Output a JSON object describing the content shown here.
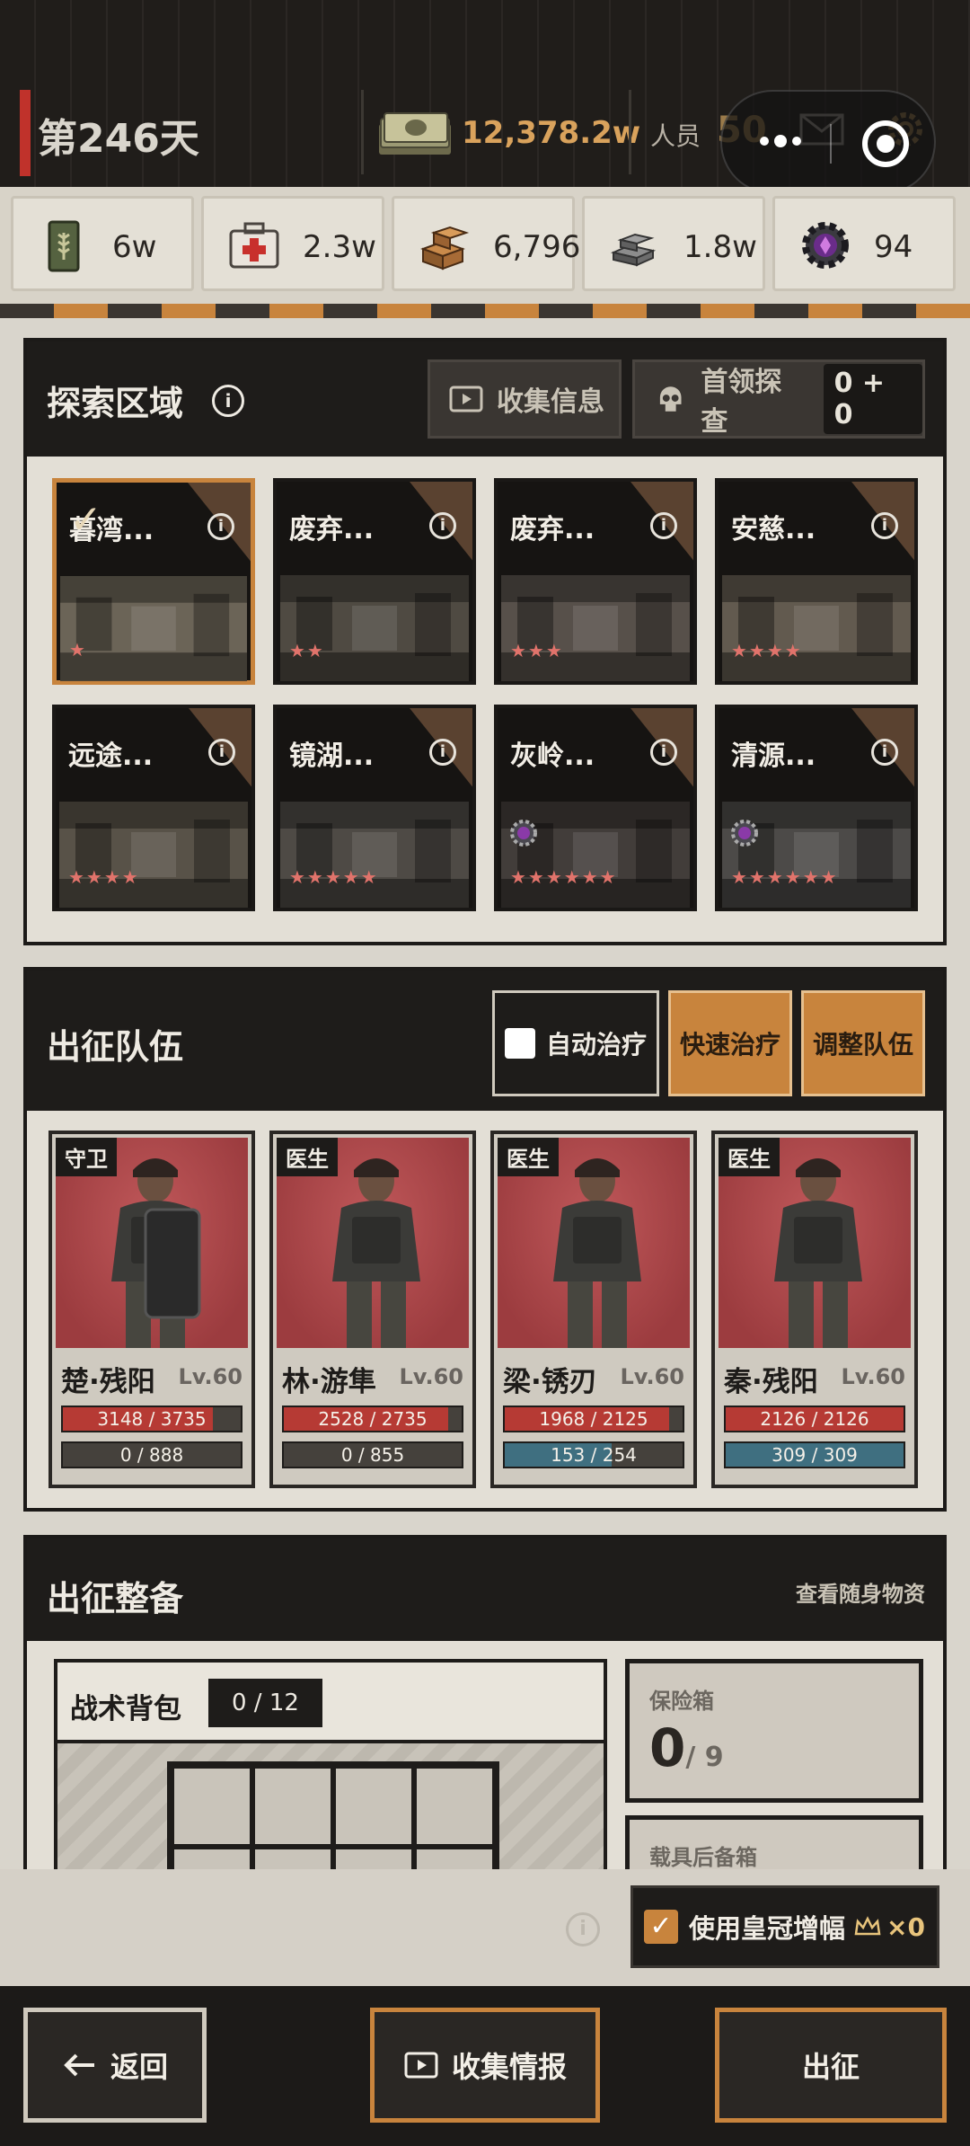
{
  "header": {
    "day": "第246天",
    "money": "12,378.2w",
    "staff_label": "人员",
    "staff_count": "50",
    "accent_color": "#c0322b"
  },
  "resources": [
    {
      "icon": "grain-can-icon",
      "value": "6w"
    },
    {
      "icon": "medkit-icon",
      "value": "2.3w"
    },
    {
      "icon": "wood-blocks-icon",
      "value": "6,796"
    },
    {
      "icon": "steel-ingot-icon",
      "value": "1.8w"
    },
    {
      "icon": "gear-chip-icon",
      "value": "94"
    }
  ],
  "explore": {
    "title": "探索区域",
    "collect_btn": "收集信息",
    "boss_btn": "首领探查",
    "boss_count": "0 + 0",
    "areas": [
      {
        "name": "暮湾...",
        "stars": "★",
        "selected": true
      },
      {
        "name": "废弃...",
        "stars": "★★"
      },
      {
        "name": "废弃...",
        "stars": "★★★"
      },
      {
        "name": "安慈...",
        "stars": "★★★★"
      },
      {
        "name": "远途...",
        "stars": "★★★★"
      },
      {
        "name": "镜湖...",
        "stars": "★★★★★"
      },
      {
        "name": "灰岭...",
        "stars": "★★★★★★",
        "badge": true
      },
      {
        "name": "清源...",
        "stars": "★★★★★★",
        "badge": true
      }
    ]
  },
  "team": {
    "title": "出征队伍",
    "auto_heal": "自动治疗",
    "quick_heal": "快速治疗",
    "adjust": "调整队伍",
    "members": [
      {
        "role": "守卫",
        "name": "楚·残阳",
        "level": "Lv.60",
        "hp": "3148 / 3735",
        "hp_ratio": 0.843,
        "sp": "0 / 888",
        "sp_ratio": 0
      },
      {
        "role": "医生",
        "name": "林·游隼",
        "level": "Lv.60",
        "hp": "2528 / 2735",
        "hp_ratio": 0.924,
        "sp": "0 / 855",
        "sp_ratio": 0
      },
      {
        "role": "医生",
        "name": "梁·锈刃",
        "level": "Lv.60",
        "hp": "1968 / 2125",
        "hp_ratio": 0.926,
        "sp": "153 / 254",
        "sp_ratio": 0.602
      },
      {
        "role": "医生",
        "name": "秦·残阳",
        "level": "Lv.60",
        "hp": "2126 / 2126",
        "hp_ratio": 1.0,
        "sp": "309 / 309",
        "sp_ratio": 1.0
      }
    ]
  },
  "prep": {
    "title": "出征整备",
    "view_items": "查看随身物资",
    "bag_title": "战术背包",
    "bag_count": "0 / 12",
    "safe_label": "保险箱",
    "safe_value": "0",
    "safe_max": "/ 9",
    "spare_label": "载具后备箱"
  },
  "crown": {
    "label": "使用皇冠增幅",
    "count": "×0"
  },
  "nav": {
    "back": "返回",
    "intel": "收集情报",
    "go": "出征"
  }
}
